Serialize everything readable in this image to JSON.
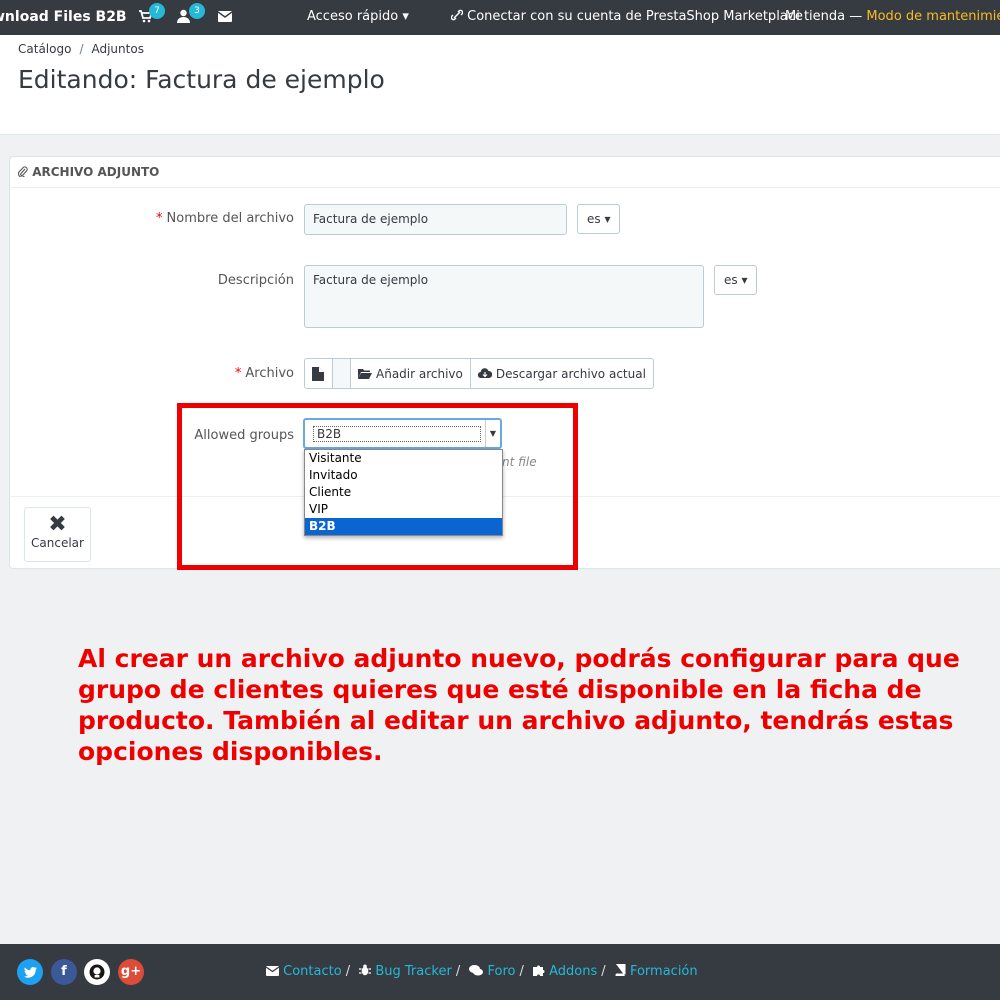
{
  "topbar": {
    "brand": "wnload Files B2B",
    "cart_badge": "7",
    "user_badge": "3",
    "quick_access": "Acceso rápido ▾",
    "connect": "Conectar con su cuenta de PrestaShop Marketplace",
    "store": "Mi tienda",
    "store_sep": " — ",
    "maintenance": "Modo de mantenimiento"
  },
  "breadcrumb": {
    "item1": "Catálogo",
    "sep": "/",
    "item2": "Adjuntos"
  },
  "page_title": "Editando: Factura de ejemplo",
  "panel": {
    "heading": "ARCHIVO ADJUNTO",
    "name_label": "Nombre del archivo",
    "name_value": "Factura de ejemplo",
    "lang": "es ▾",
    "desc_label": "Descripción",
    "desc_value": "Factura de ejemplo",
    "file_label": "Archivo",
    "add_file": "Añadir archivo",
    "download_current": "Descargar archivo actual",
    "groups_label": "Allowed groups",
    "groups_selected": "B2B",
    "hint_fragment": "nt file",
    "cancel": "Cancelar"
  },
  "dropdown": {
    "options": [
      "Visitante",
      "Invitado",
      "Cliente",
      "VIP",
      "B2B"
    ],
    "selected_index": 4
  },
  "annotation": "Al crear un archivo adjunto nuevo, podrás configurar para que grupo de clientes quieres que esté disponible en la ficha de producto. También al editar un archivo adjunto, tendrás estas opciones disponibles.",
  "footer": {
    "contact": "Contacto",
    "bug": "Bug Tracker",
    "forum": "Foro",
    "addons": "Addons",
    "training": "Formación",
    "sep": "/"
  },
  "colors": {
    "topbar": "#363a41",
    "accent": "#25b9d7",
    "maintenance": "#fbbb22",
    "highlight": "#ee0000",
    "twitter": "#1da1f2",
    "facebook": "#3b5998",
    "github": "#ffffff",
    "google": "#dd4b39"
  }
}
